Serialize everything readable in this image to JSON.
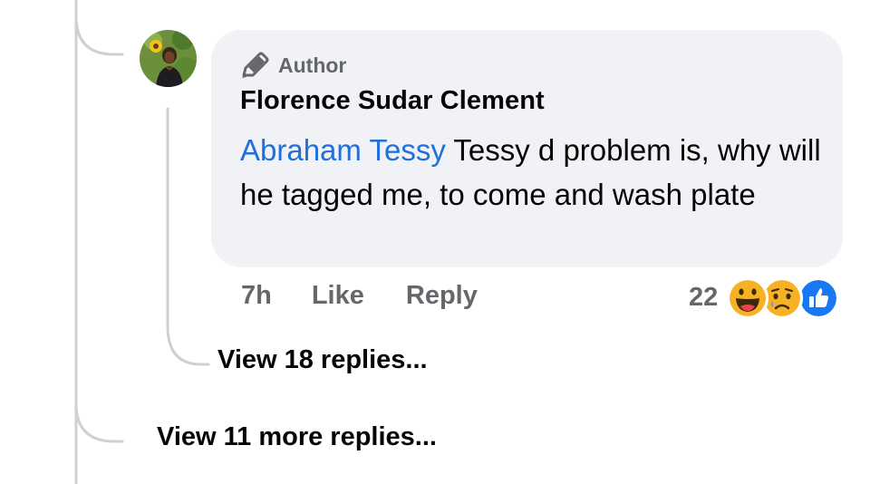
{
  "comment": {
    "badge_label": "Author",
    "commenter_name": "Florence Sudar Clement",
    "mention": "Abraham Tessy",
    "body_text": " Tessy d problem is, why will he tagged me, to come and wash plate",
    "time": "7h",
    "like_label": "Like",
    "reply_label": "Reply",
    "reaction_count": "22",
    "reactions": [
      "haha-icon",
      "sad-icon",
      "like-reaction-icon"
    ]
  },
  "thread": {
    "view_replies_label": "View 18 replies...",
    "view_more_label": "View 11 more replies..."
  },
  "colors": {
    "bubble_bg": "#f0f2f5",
    "mention": "#216fdb",
    "muted_text": "#65676b",
    "thread_line": "#ced0d4",
    "like_blue": "#1877f2",
    "haha_yellow": "#f7b125"
  }
}
